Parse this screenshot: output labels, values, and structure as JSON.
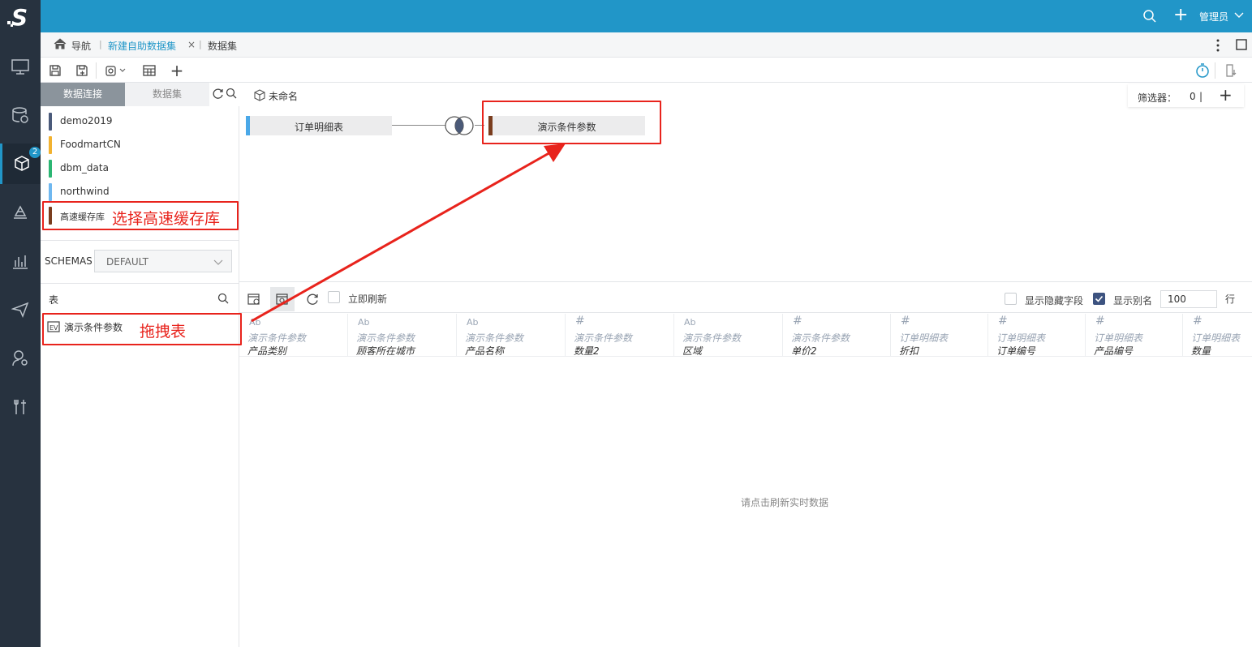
{
  "topbar": {
    "user": "管理员"
  },
  "rail": {
    "badge": "2"
  },
  "breadcrumb": {
    "nav": "导航",
    "tab_active": "新建自助数据集",
    "tab_close": "×",
    "tab_other": "数据集"
  },
  "leftpanel": {
    "tab_connections": "数据连接",
    "tab_datasets": "数据集",
    "connections": [
      {
        "label": "demo2019",
        "color": "#4a5a7a"
      },
      {
        "label": "FoodmartCN",
        "color": "#f2b230"
      },
      {
        "label": "dbm_data",
        "color": "#2bb673"
      },
      {
        "label": "northwind",
        "color": "#6fb8f0"
      },
      {
        "label": "高速缓存库",
        "color": "#7a3d1e"
      }
    ],
    "schemas_label": "SCHEMAS",
    "schemas_value": "DEFAULT",
    "tables_title": "表",
    "table_item": "演示条件参数"
  },
  "canvas": {
    "title": "未命名",
    "filter_label": "筛选器：",
    "filter_count": "0",
    "filter_sep": "|",
    "filter_add": "+",
    "node_left": {
      "label": "订单明细表",
      "color": "#4aa8e8"
    },
    "node_right": {
      "label": "演示条件参数",
      "color": "#7a3d1e"
    }
  },
  "preview": {
    "auto_refresh": "立即刷新",
    "show_hidden": "显示隐藏字段",
    "show_alias": "显示别名",
    "rows_value": "100",
    "rows_unit": "行",
    "empty_message": "请点击刷新实时数据",
    "columns": [
      {
        "type": "Ab",
        "table": "演示条件参数",
        "field": "产品类别"
      },
      {
        "type": "Ab",
        "table": "演示条件参数",
        "field": "顾客所在城市"
      },
      {
        "type": "Ab",
        "table": "演示条件参数",
        "field": "产品名称"
      },
      {
        "type": "#",
        "table": "演示条件参数",
        "field": "数量2"
      },
      {
        "type": "Ab",
        "table": "演示条件参数",
        "field": "区域"
      },
      {
        "type": "#",
        "table": "演示条件参数",
        "field": "单价2"
      },
      {
        "type": "#",
        "table": "订单明细表",
        "field": "折扣"
      },
      {
        "type": "#",
        "table": "订单明细表",
        "field": "订单编号"
      },
      {
        "type": "#",
        "table": "订单明细表",
        "field": "产品编号"
      },
      {
        "type": "#",
        "table": "订单明细表",
        "field": "数量"
      }
    ]
  },
  "annotations": {
    "select_cache": "选择高速缓存库",
    "drag_table": "拖拽表"
  }
}
